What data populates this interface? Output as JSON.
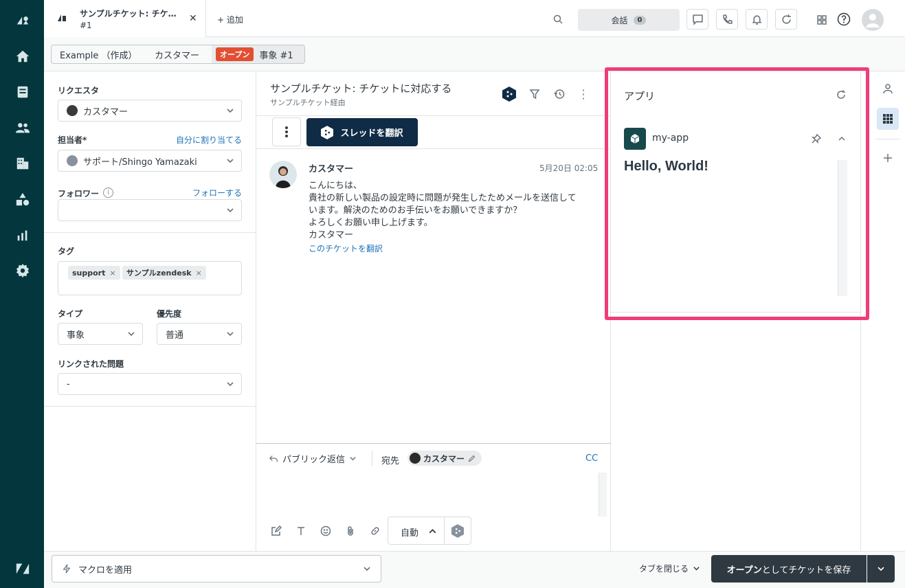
{
  "colors": {
    "nav_bg": "#03363d",
    "accent_link": "#1f73b7",
    "open_badge": "#e34f32",
    "highlight": "#ef3d7a",
    "dark_btn": "#17494d"
  },
  "nav": {
    "items": [
      {
        "icon": "zendesk-logo-icon"
      },
      {
        "icon": "home-icon"
      },
      {
        "icon": "views-icon"
      },
      {
        "icon": "customers-icon"
      },
      {
        "icon": "organizations-icon"
      },
      {
        "icon": "admin-shapes-icon"
      },
      {
        "icon": "reporting-icon"
      },
      {
        "icon": "settings-icon"
      },
      {
        "icon": "zendesk-z-icon"
      }
    ]
  },
  "topbar": {
    "tab_title": "サンプルチケット: チケ…",
    "tab_sub": "#1",
    "add_label": "+ 追加",
    "conversations_label": "会話",
    "conversations_count": "0"
  },
  "breadcrumbs": {
    "org": "Example （作成）",
    "user": "カスタマー",
    "status": "オープン",
    "ticket": "事象 #1"
  },
  "props": {
    "requester_label": "リクエスタ",
    "requester_value": "カスタマー",
    "assignee_label": "担当者*",
    "assign_self": "自分に割り当てる",
    "assignee_value": "サポート/Shingo Yamazaki",
    "followers_label": "フォロワー",
    "follow_link": "フォローする",
    "tags_label": "タグ",
    "tags": [
      "support",
      "サンプルzendesk"
    ],
    "type_label": "タイプ",
    "type_value": "事象",
    "priority_label": "優先度",
    "priority_value": "普通",
    "linked_label": "リンクされた問題",
    "linked_value": "-"
  },
  "ticket": {
    "title": "サンプルチケット: チケットに対応する",
    "via": "サンプルチケット経由",
    "translate_btn": "スレッドを翻訳",
    "author": "カスタマー",
    "time": "5月20日 02:05",
    "body": [
      "こんにちは、",
      "貴社の新しい製品の設定時に問題が発生したためメールを送信して",
      "います。解決のためのお手伝いをお願いできますか？",
      "よろしくお願い申し上げます。",
      "カスタマー"
    ],
    "translate_link": "このチケットを翻訳"
  },
  "composer": {
    "reply_mode": "パブリック返信",
    "to_label": "宛先",
    "to_value": "カスタマー",
    "cc": "CC",
    "auto_label": "自動"
  },
  "apps": {
    "title": "アプリ",
    "app_name": "my-app",
    "app_content": "Hello, World!"
  },
  "bottom": {
    "macro": "マクロを適用",
    "close_tab": "タブを閉じる",
    "save_status": "オープン",
    "save_suffix": "としてチケットを保存"
  }
}
